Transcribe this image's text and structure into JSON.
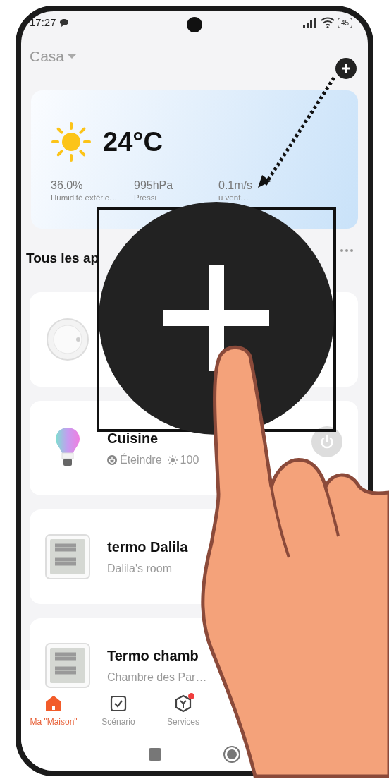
{
  "status_bar": {
    "time": "17:27",
    "battery": "45"
  },
  "header": {
    "home": "Casa"
  },
  "weather": {
    "temperature": "24°C",
    "stats": [
      {
        "value": "36.0%",
        "label": "Humidité extérie…"
      },
      {
        "value": "995hPa",
        "label": "Pressi"
      },
      {
        "value": "0.1m/s",
        "label": "u vent…"
      }
    ]
  },
  "section": {
    "title": "Tous les ap"
  },
  "devices": [
    {
      "kind": "sensor"
    },
    {
      "kind": "bulb",
      "name": "Cuisine",
      "details": [
        "Éteindre",
        "100"
      ]
    },
    {
      "kind": "thermo",
      "name": "termo Dalila",
      "details": [
        "Dalila's room"
      ]
    },
    {
      "kind": "thermo",
      "name": "Termo  chamb",
      "details": [
        "Chambre des Par…"
      ]
    }
  ],
  "tabs": [
    {
      "label": "Ma \"Maison\"",
      "selected": true,
      "badge": false
    },
    {
      "label": "Scénario",
      "selected": false,
      "badge": false
    },
    {
      "label": "Services",
      "selected": false,
      "badge": true
    }
  ]
}
